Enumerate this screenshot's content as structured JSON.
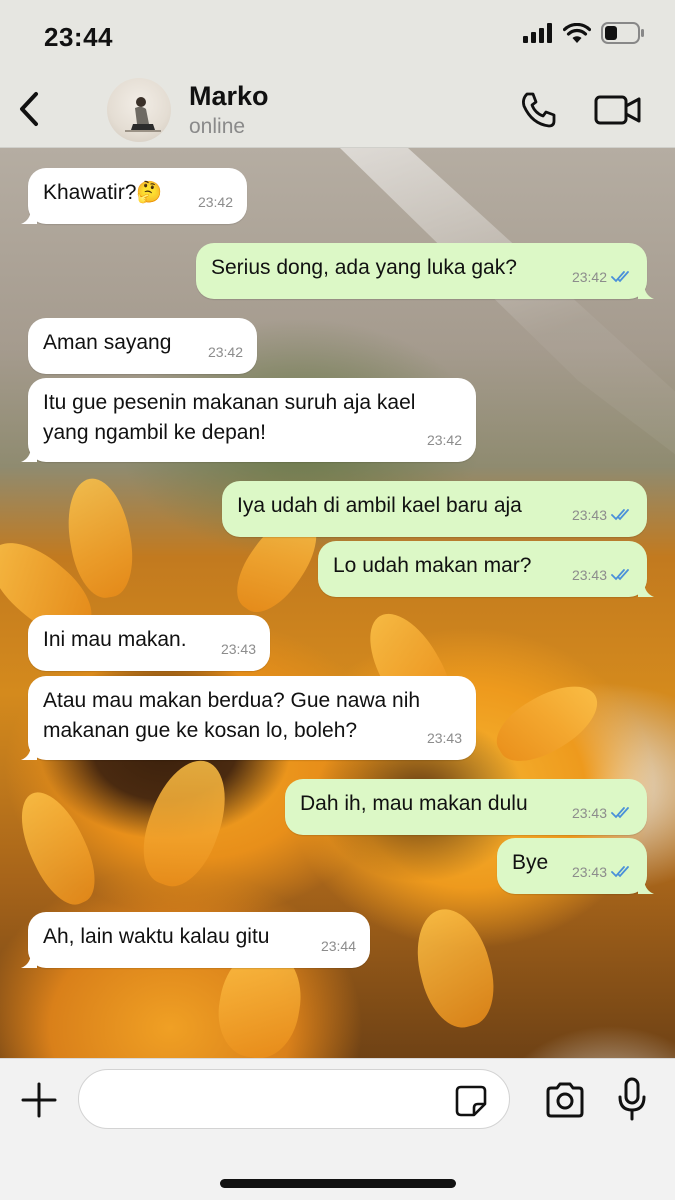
{
  "status_bar": {
    "time": "23:44"
  },
  "header": {
    "contact_name": "Marko",
    "contact_status": "online"
  },
  "messages": [
    {
      "dir": "in",
      "text": "Khawatir?🤔",
      "time": "23:42"
    },
    {
      "dir": "out",
      "text": "Serius dong, ada yang luka gak?",
      "time": "23:42",
      "read": true
    },
    {
      "dir": "in",
      "text": "Aman sayang",
      "time": "23:42"
    },
    {
      "dir": "in",
      "text": "Itu gue pesenin makanan suruh aja kael\nyang ngambil ke depan!",
      "time": "23:42"
    },
    {
      "dir": "out",
      "text": "Iya udah di ambil kael baru aja",
      "time": "23:43",
      "read": true
    },
    {
      "dir": "out",
      "text": "Lo udah makan mar?",
      "time": "23:43",
      "read": true
    },
    {
      "dir": "in",
      "text": "Ini mau makan.",
      "time": "23:43"
    },
    {
      "dir": "in",
      "text": "Atau mau makan berdua? Gue nawa nih\nmakanan gue ke kosan lo, boleh?",
      "time": "23:43"
    },
    {
      "dir": "out",
      "text": "Dah ih, mau makan dulu",
      "time": "23:43",
      "read": true
    },
    {
      "dir": "out",
      "text": "Bye",
      "time": "23:43",
      "read": true
    },
    {
      "dir": "in",
      "text": "Ah, lain waktu kalau gitu",
      "time": "23:44"
    }
  ],
  "composer": {
    "placeholder": ""
  },
  "colors": {
    "incoming_bubble": "#ffffff",
    "outgoing_bubble": "#dcf8c6",
    "read_ticks": "#4a90d9"
  },
  "icons": [
    "back-icon",
    "phone-icon",
    "video-camera-icon",
    "plus-icon",
    "sticker-icon",
    "camera-icon",
    "microphone-icon",
    "double-check-icon"
  ]
}
